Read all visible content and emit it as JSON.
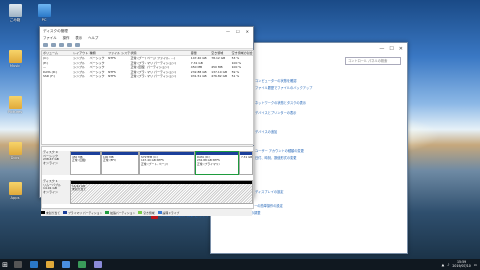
{
  "colors": {
    "accent": "#1b3f9a",
    "primary_partition": "#1b3f9a",
    "selected_border": "#1f9b3e",
    "taskbar": "#101820",
    "unallocated": "#000000"
  },
  "desktop": {
    "icons": [
      {
        "label": "ごみ箱",
        "icon": "recycle-bin-icon"
      },
      {
        "label": "PC",
        "icon": "computer-icon"
      },
      {
        "label": "Music",
        "icon": "folder-icon"
      },
      {
        "label": "Pictures",
        "icon": "folder-icon"
      },
      {
        "label": "Docs",
        "icon": "folder-icon"
      },
      {
        "label": "Apps",
        "icon": "folder-icon"
      }
    ]
  },
  "disk_mgmt": {
    "title": "ディスクの管理",
    "menu": [
      "ファイル",
      "操作",
      "表示",
      "ヘルプ"
    ],
    "volume_header": [
      "ボリューム",
      "レイアウト",
      "種類",
      "ファイル システム",
      "状態",
      "",
      "容量",
      "空き領域",
      "空き領域の割合"
    ],
    "volumes": [
      [
        "(C:)",
        "シンプル",
        "ベーシック",
        "NTFS",
        "正常 (ブート,",
        "ページ ファイル, ...)",
        "147.40 GB",
        "78.12 GB",
        "53 %"
      ],
      [
        "(E:)",
        "シンプル",
        "ベーシック",
        "",
        "正常 (プライ",
        "マリ パーティション)",
        "7.31 GB",
        "",
        "100 %"
      ],
      [
        "—",
        "シンプル",
        "ベーシック",
        "",
        "正常 (回復",
        "パーティション)",
        "450 MB",
        "450 MB",
        "100 %"
      ],
      [
        "DATA (D:)",
        "シンプル",
        "ベーシック",
        "NTFS",
        "正常 (プライ",
        "マリ パーティション)",
        "232.88 GB",
        "137.10 GB",
        "59 %"
      ],
      [
        "SSD (F:)",
        "シンプル",
        "ベーシック",
        "NTFS",
        "正常 (プライ",
        "マリ パーティション)",
        "931.51 GB",
        "476.82 GB",
        "51 %"
      ]
    ],
    "disks": [
      {
        "name": "ディスク 0",
        "type": "ベーシック",
        "size": "238.47 GB",
        "status": "オンライン",
        "parts": [
          {
            "title": "",
            "size": "450 MB",
            "status": "正常 (回復)"
          },
          {
            "title": "",
            "size": "100 MB",
            "status": "正常 (EFI)"
          },
          {
            "title": "SYSTEM (C:)",
            "size": "147.40 GB NTFS",
            "status": "正常 (ブート, ページ)"
          },
          {
            "title": "DATA (D:)",
            "size": "232.88 GB NTFS",
            "status": "正常 (プライマリ)"
          },
          {
            "title": "",
            "size": "7.31 GB",
            "status": "正常 (回復)"
          }
        ]
      },
      {
        "name": "ディスク 1",
        "type": "リムーバブル",
        "size": "14.91 GB",
        "status": "オンライン",
        "parts": [
          {
            "title": "",
            "size": "14.91 GB",
            "status": "未割り当て"
          }
        ]
      }
    ],
    "legend": [
      "未割り当て",
      "プライマリ パーティション",
      "拡張パーティション",
      "空き領域",
      "論理ドライブ"
    ]
  },
  "control_panel": {
    "search_placeholder": "コントロール パネルの検索",
    "links": [
      "コンピューターの状態を確認",
      "ファイル履歴でファイルのバックアップ",
      "ネットワークの状態とタスクの表示",
      "デバイスとプリンターの表示",
      "デバイスの追加",
      "ユーザー アカウントの種類の変更",
      "日付、時刻、数値形式の変更",
      "ディスプレイの設定",
      "コンピューターの簡単操作の設定",
      "表示サイズの調整"
    ],
    "flash_label": "Flash Player (32 ビット)"
  },
  "taskbar": {
    "time": "15:59",
    "date": "2019/07/10"
  }
}
